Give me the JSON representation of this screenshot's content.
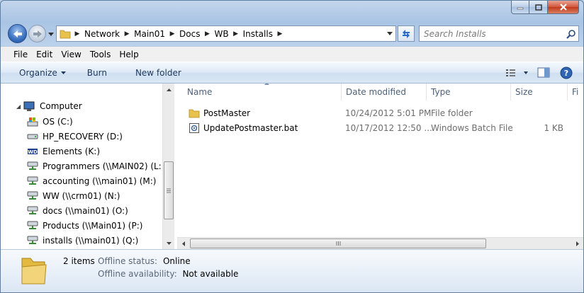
{
  "window": {
    "colors": {
      "accent": "#1e395b"
    }
  },
  "address": {
    "crumbs": [
      "Network",
      "Main01",
      "Docs",
      "WB",
      "Installs"
    ]
  },
  "search": {
    "placeholder": "Search Installs"
  },
  "menu": [
    "File",
    "Edit",
    "View",
    "Tools",
    "Help"
  ],
  "toolbar": {
    "organize": "Organize",
    "burn": "Burn",
    "new_folder": "New folder"
  },
  "nav": {
    "root": "Computer",
    "items": [
      {
        "label": "OS (C:)",
        "icon": "os-drive-icon"
      },
      {
        "label": "HP_RECOVERY (D:)",
        "icon": "drive-icon"
      },
      {
        "label": "Elements (K:)",
        "icon": "wd-drive-icon"
      },
      {
        "label": "Programmers (\\\\MAIN02) (L:)",
        "icon": "network-drive-icon"
      },
      {
        "label": "accounting (\\\\main01) (M:)",
        "icon": "network-drive-icon"
      },
      {
        "label": "WW (\\\\crm01) (N:)",
        "icon": "network-drive-icon"
      },
      {
        "label": "docs (\\\\main01) (O:)",
        "icon": "network-drive-icon"
      },
      {
        "label": "Products (\\\\Main01) (P:)",
        "icon": "network-drive-icon"
      },
      {
        "label": "installs (\\\\main01) (Q:)",
        "icon": "network-drive-icon"
      }
    ]
  },
  "columns": {
    "name": "Name",
    "date": "Date modified",
    "type": "Type",
    "size": "Size",
    "extra": "Fi"
  },
  "files": [
    {
      "name": "PostMaster",
      "date": "10/24/2012 5:01 PM",
      "type": "File folder",
      "size": "",
      "icon": "folder-icon"
    },
    {
      "name": "UpdatePostmaster.bat",
      "date": "10/17/2012 12:50 ...",
      "type": "Windows Batch File",
      "size": "1 KB",
      "icon": "batch-file-icon"
    }
  ],
  "details": {
    "count": "2 items",
    "offline_status_label": "Offline status:",
    "offline_status_value": "Online",
    "offline_avail_label": "Offline availability:",
    "offline_avail_value": "Not available"
  }
}
